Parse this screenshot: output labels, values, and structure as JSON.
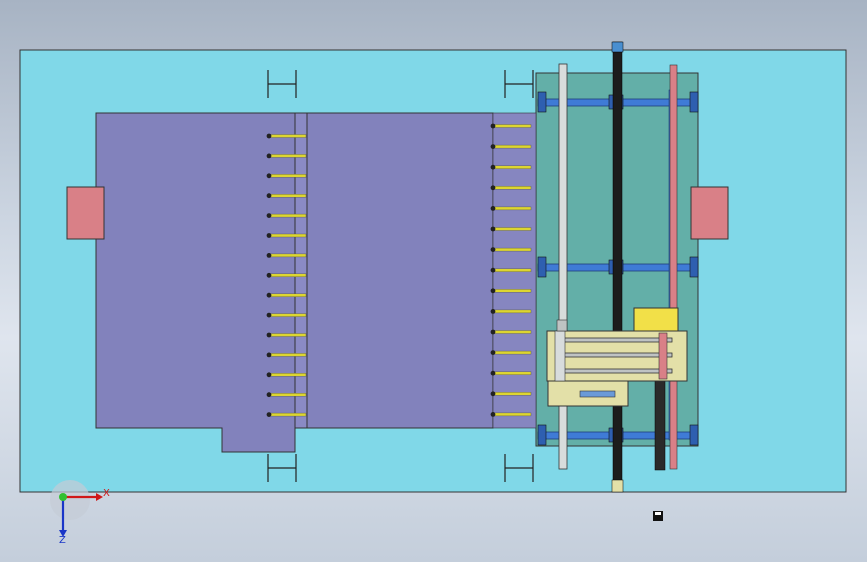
{
  "viewport": {
    "background": "CAD top view",
    "colors": {
      "plate": "#80d8e8",
      "platform": "#8282bc",
      "pink_block": "#d98087",
      "teal_frame": "#63afa8",
      "blue_rail": "#3f7bd6",
      "yellow_pin": "#ddd630",
      "carriage": "#e3e0a8",
      "motor": "#f2e048",
      "chain": "#1c1c1c"
    }
  },
  "triad": {
    "x_label": "X",
    "z_label": "Z"
  },
  "icons": {
    "save": "save-icon"
  },
  "pin_rows": {
    "left_count": 15,
    "right_count": 15
  }
}
